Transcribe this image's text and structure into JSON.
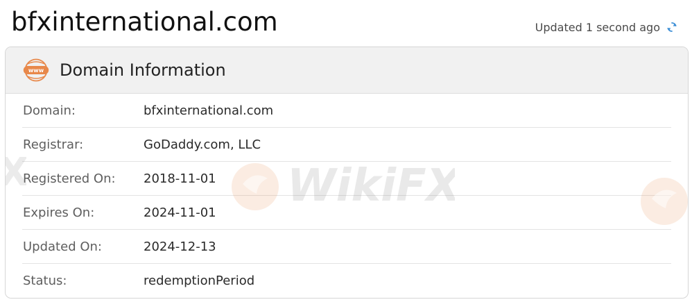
{
  "page": {
    "title": "bfxinternational.com",
    "updated_text": "Updated 1 second ago",
    "refresh_icon": "refresh-icon"
  },
  "card": {
    "title": "Domain Information",
    "header_icon": "www-icon",
    "header_icon_text": "www",
    "rows": [
      {
        "label": "Domain:",
        "value": "bfxinternational.com"
      },
      {
        "label": "Registrar:",
        "value": "GoDaddy.com, LLC"
      },
      {
        "label": "Registered On:",
        "value": "2018-11-01"
      },
      {
        "label": "Expires On:",
        "value": "2024-11-01"
      },
      {
        "label": "Updated On:",
        "value": "2024-12-13"
      },
      {
        "label": "Status:",
        "value": "redemptionPeriod"
      }
    ]
  },
  "watermark": {
    "text": "WikiFX",
    "fragment": "X"
  },
  "colors": {
    "accent_orange": "#e8884a",
    "refresh_blue": "#3d8fd6",
    "header_bg": "#f1f1f1"
  }
}
